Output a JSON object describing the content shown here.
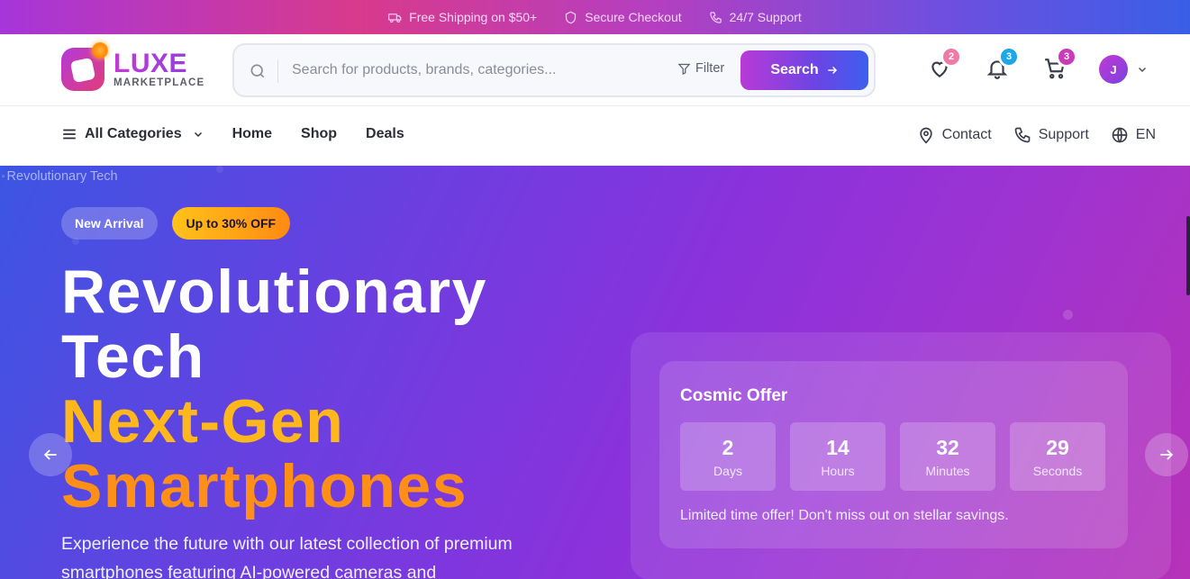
{
  "topbar": {
    "items": [
      {
        "label": "Free Shipping on $50+",
        "icon": "truck-icon"
      },
      {
        "label": "Secure Checkout",
        "icon": "shield-icon"
      },
      {
        "label": "24/7 Support",
        "icon": "phone-icon"
      }
    ]
  },
  "header": {
    "brand": "LUXE",
    "brand_sub": "MARKETPLACE",
    "search_placeholder": "Search for products, brands, categories...",
    "filter_label": "Filter",
    "search_button": "Search",
    "wishlist_count": "2",
    "notifications_count": "3",
    "cart_count": "3",
    "avatar_initial": "J"
  },
  "nav": {
    "all_categories": "All Categories",
    "links": [
      "Home",
      "Shop",
      "Deals"
    ],
    "right": {
      "contact": "Contact",
      "support": "Support",
      "language": "EN"
    }
  },
  "hero": {
    "image_alt": "Revolutionary Tech",
    "tag_new": "New Arrival",
    "tag_discount": "Up to 30% OFF",
    "headline_line1": "Revolutionary",
    "headline_line2": "Tech",
    "headline_line3": "Next-Gen",
    "headline_line4": "Smartphones",
    "description": "Experience the future with our latest collection of premium smartphones featuring AI-powered cameras and",
    "offer": {
      "title": "Cosmic Offer",
      "days": "2",
      "days_label": "Days",
      "hours": "14",
      "hours_label": "Hours",
      "minutes": "32",
      "minutes_label": "Minutes",
      "seconds": "29",
      "seconds_label": "Seconds",
      "note": "Limited time offer! Don't miss out on stellar savings."
    }
  },
  "colors": {
    "accent_purple": "#8a3fe0",
    "accent_pink": "#e23c7a",
    "highlight_yellow": "#ffb81c",
    "highlight_orange": "#ff8f16",
    "badge_wishlist": "#f07aa5",
    "badge_notifications": "#1ea7e6",
    "badge_cart": "#c93bb9"
  }
}
